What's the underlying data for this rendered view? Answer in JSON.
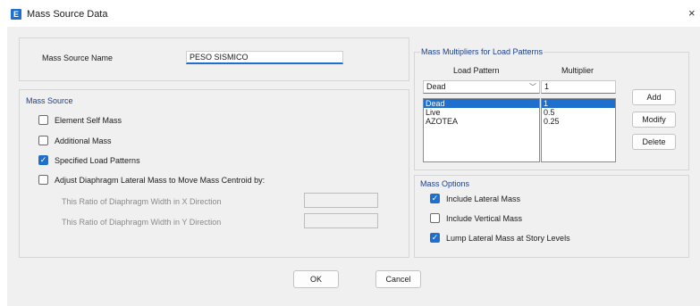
{
  "window": {
    "title": "Mass Source Data",
    "icon_letter": "E",
    "close_glyph": "×"
  },
  "mass_source_name": {
    "label": "Mass Source Name",
    "value": "PESO SISMICO"
  },
  "mass_source": {
    "title": "Mass Source",
    "options": [
      {
        "label": "Element Self Mass",
        "checked": false
      },
      {
        "label": "Additional Mass",
        "checked": false
      },
      {
        "label": "Specified Load Patterns",
        "checked": true
      },
      {
        "label": "Adjust Diaphragm Lateral Mass to Move Mass Centroid by:",
        "checked": false
      }
    ],
    "ratio_x_label": "This Ratio of Diaphragm Width in X Direction",
    "ratio_y_label": "This Ratio of Diaphragm Width in Y Direction",
    "ratio_x_value": "",
    "ratio_y_value": ""
  },
  "multipliers": {
    "title": "Mass Multipliers for Load Patterns",
    "col_load_pattern": "Load Pattern",
    "col_multiplier": "Multiplier",
    "selected_pattern": "Dead",
    "multiplier_input": "1",
    "rows": [
      {
        "pattern": "Dead",
        "multiplier": "1",
        "selected": true
      },
      {
        "pattern": "Live",
        "multiplier": "0.5",
        "selected": false
      },
      {
        "pattern": "AZOTEA",
        "multiplier": "0.25",
        "selected": false
      }
    ],
    "buttons": {
      "add": "Add",
      "modify": "Modify",
      "delete": "Delete"
    }
  },
  "mass_options": {
    "title": "Mass Options",
    "options": [
      {
        "label": "Include Lateral Mass",
        "checked": true
      },
      {
        "label": "Include Vertical Mass",
        "checked": false
      },
      {
        "label": "Lump Lateral Mass at Story Levels",
        "checked": true
      }
    ]
  },
  "footer": {
    "ok": "OK",
    "cancel": "Cancel"
  },
  "colors": {
    "accent": "#1f6fce",
    "group_title": "#1b3f8b",
    "background": "#f0f0f0"
  },
  "icons": {
    "close": "close-icon",
    "app": "etabs-app-icon",
    "check": "check-icon",
    "dropdown": "chevron-down-icon"
  }
}
